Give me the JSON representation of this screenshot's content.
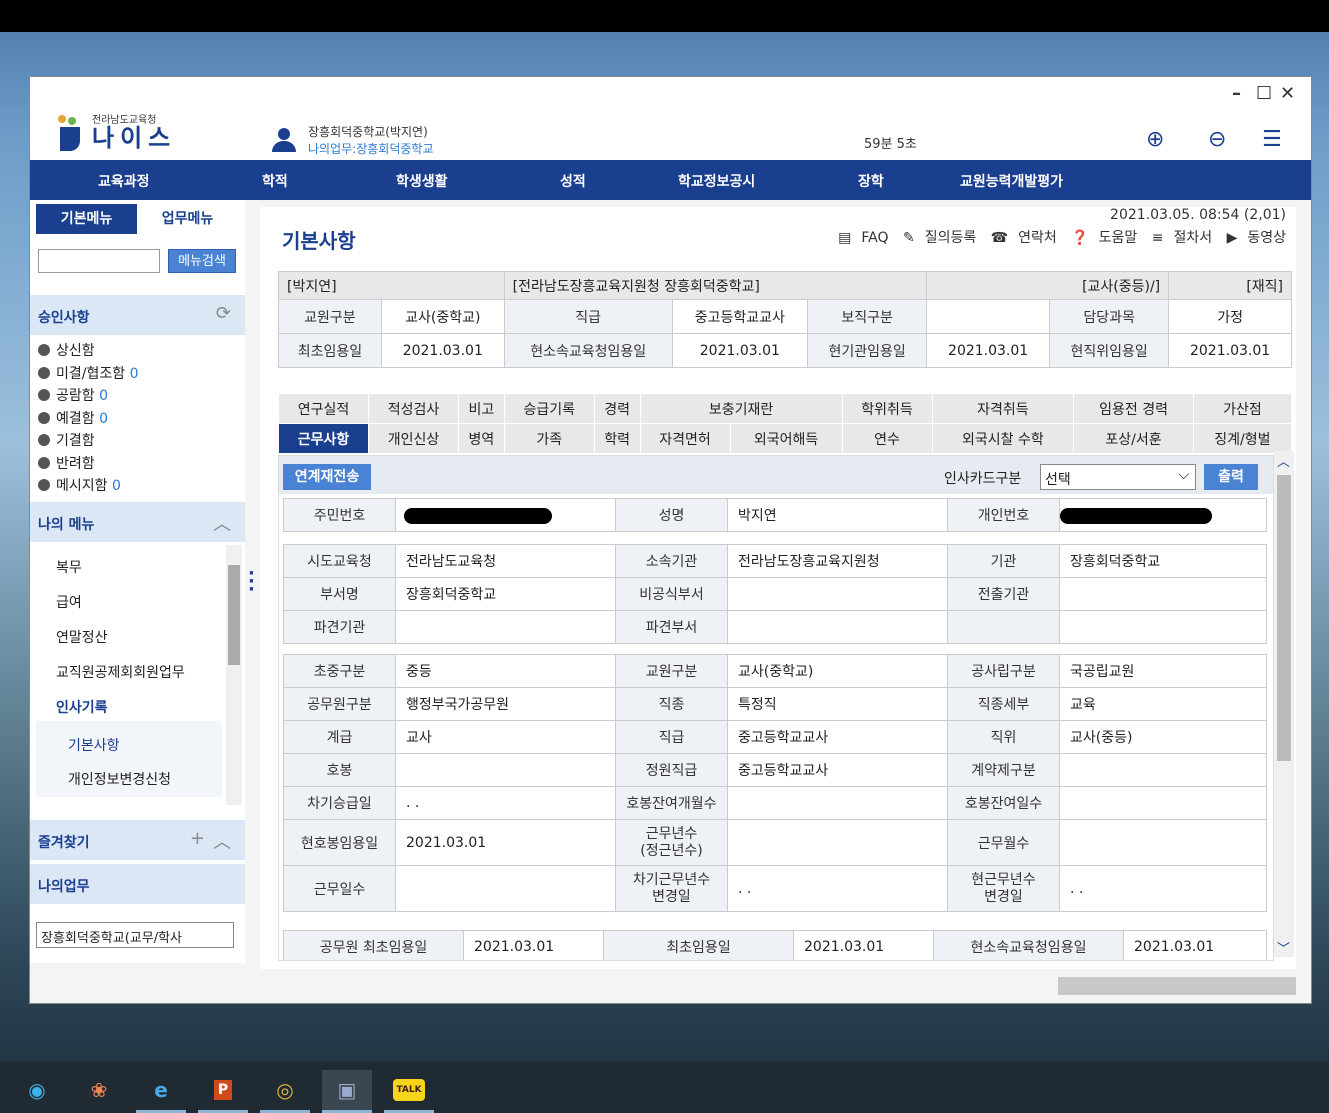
{
  "window": {
    "min_icon": "minimize-icon",
    "max_icon": "maximize-icon",
    "close_icon": "close-icon"
  },
  "header": {
    "org_small": "전라남도교육청",
    "app_name": "나이스",
    "user_name": "장흥회덕중학교(박지연)",
    "user_context": "나의업무:장흥회덕중학교",
    "session_timer": "59분 5초"
  },
  "nav": [
    "교육과정",
    "학적",
    "학생생활",
    "성적",
    "학교정보공시",
    "장학",
    "교원능력개발평가"
  ],
  "sidebar": {
    "tab_basic": "기본메뉴",
    "tab_work": "업무메뉴",
    "search_button": "메뉴검색",
    "approval_title": "승인사항",
    "approval_items": [
      {
        "label": "상신함",
        "count": ""
      },
      {
        "label": "미결/협조함",
        "count": "0"
      },
      {
        "label": "공람함",
        "count": "0"
      },
      {
        "label": "예결함",
        "count": "0"
      },
      {
        "label": "기결함",
        "count": ""
      },
      {
        "label": "반려함",
        "count": ""
      },
      {
        "label": "메시지함",
        "count": "0"
      }
    ],
    "mymenu_title": "나의 메뉴",
    "mymenu_items": [
      "복무",
      "급여",
      "연말정산",
      "교직원공제회회원업무",
      "인사기록"
    ],
    "mymenu_sub": [
      "기본사항",
      "개인정보변경신청"
    ],
    "favorites_title": "즐겨찾기",
    "mywork_title": "나의업무",
    "mywork_select": "장흥회덕중학교(교무/학사"
  },
  "main": {
    "title": "기본사항",
    "datetime": "2021.03.05. 08:54 (2,01)",
    "links": [
      "FAQ",
      "질의등록",
      "연락처",
      "도움말",
      "절차서",
      "동영상"
    ],
    "summary": {
      "name": "[박지연]",
      "org": "[전라남도장흥교육지원청 장흥회덕중학교]",
      "rank": "[교사(중등)/]",
      "status": "[재직]"
    },
    "info_rows": [
      [
        [
          "교원구분",
          "교사(중학교)"
        ],
        [
          "직급",
          "중고등학교교사"
        ],
        [
          "보직구분",
          ""
        ],
        [
          "담당과목",
          "가정"
        ]
      ],
      [
        [
          "최초임용일",
          "2021.03.01"
        ],
        [
          "현소속교육청임용일",
          "2021.03.01"
        ],
        [
          "현기관임용일",
          "2021.03.01"
        ],
        [
          "현직위임용일",
          "2021.03.01"
        ]
      ]
    ],
    "tabs_row1": [
      "연구실적",
      "적성검사",
      "비고",
      "승급기록",
      "경력",
      "보충기재란",
      "학위취득",
      "자격취득",
      "임용전 경력",
      "가산점"
    ],
    "tabs_row2": [
      "근무사항",
      "개인신상",
      "병역",
      "가족",
      "학력",
      "자격면허",
      "외국어해득",
      "연수",
      "외국시찰 수학",
      "포상/서훈",
      "징계/형벌"
    ],
    "resend_button": "연계재전송",
    "card_label": "인사카드구분",
    "card_select": "선택",
    "print_button": "출력",
    "grid1": [
      [
        "주민번호",
        "",
        "성명",
        "박지연",
        "개인번호",
        ""
      ]
    ],
    "grid2": [
      [
        "시도교육청",
        "전라남도교육청",
        "소속기관",
        "전라남도장흥교육지원청",
        "기관",
        "장흥회덕중학교"
      ],
      [
        "부서명",
        "장흥회덕중학교",
        "비공식부서",
        "",
        "전출기관",
        ""
      ],
      [
        "파견기관",
        "",
        "파견부서",
        "",
        "",
        ""
      ]
    ],
    "grid3": [
      [
        "초중구분",
        "중등",
        "교원구분",
        "교사(중학교)",
        "공사립구분",
        "국공립교원"
      ],
      [
        "공무원구분",
        "행정부국가공무원",
        "직종",
        "특정직",
        "직종세부",
        "교육"
      ],
      [
        "계급",
        "교사",
        "직급",
        "중고등학교교사",
        "직위",
        "교사(중등)"
      ],
      [
        "호봉",
        "",
        "정원직급",
        "중고등학교교사",
        "계약제구분",
        ""
      ],
      [
        "차기승급일",
        ". .",
        "호봉잔여개월수",
        "",
        "호봉잔여일수",
        ""
      ],
      [
        "현호봉임용일",
        "2021.03.01",
        "근무년수\n(정근년수)",
        "",
        "근무월수",
        ""
      ],
      [
        "근무일수",
        "",
        "차기근무년수\n변경일",
        ". .",
        "현근무년수\n변경일",
        ". ."
      ]
    ],
    "grid4": [
      [
        "공무원 최초임용일",
        "2021.03.01",
        "최초임용일",
        "2021.03.01",
        "현소속교육청임용일",
        "2021.03.01"
      ]
    ]
  },
  "taskbar": [
    "edge-icon",
    "paint-icon",
    "ie-icon",
    "powerpoint-icon",
    "chrome-icon",
    "app-icon",
    "kakaotalk-icon"
  ]
}
